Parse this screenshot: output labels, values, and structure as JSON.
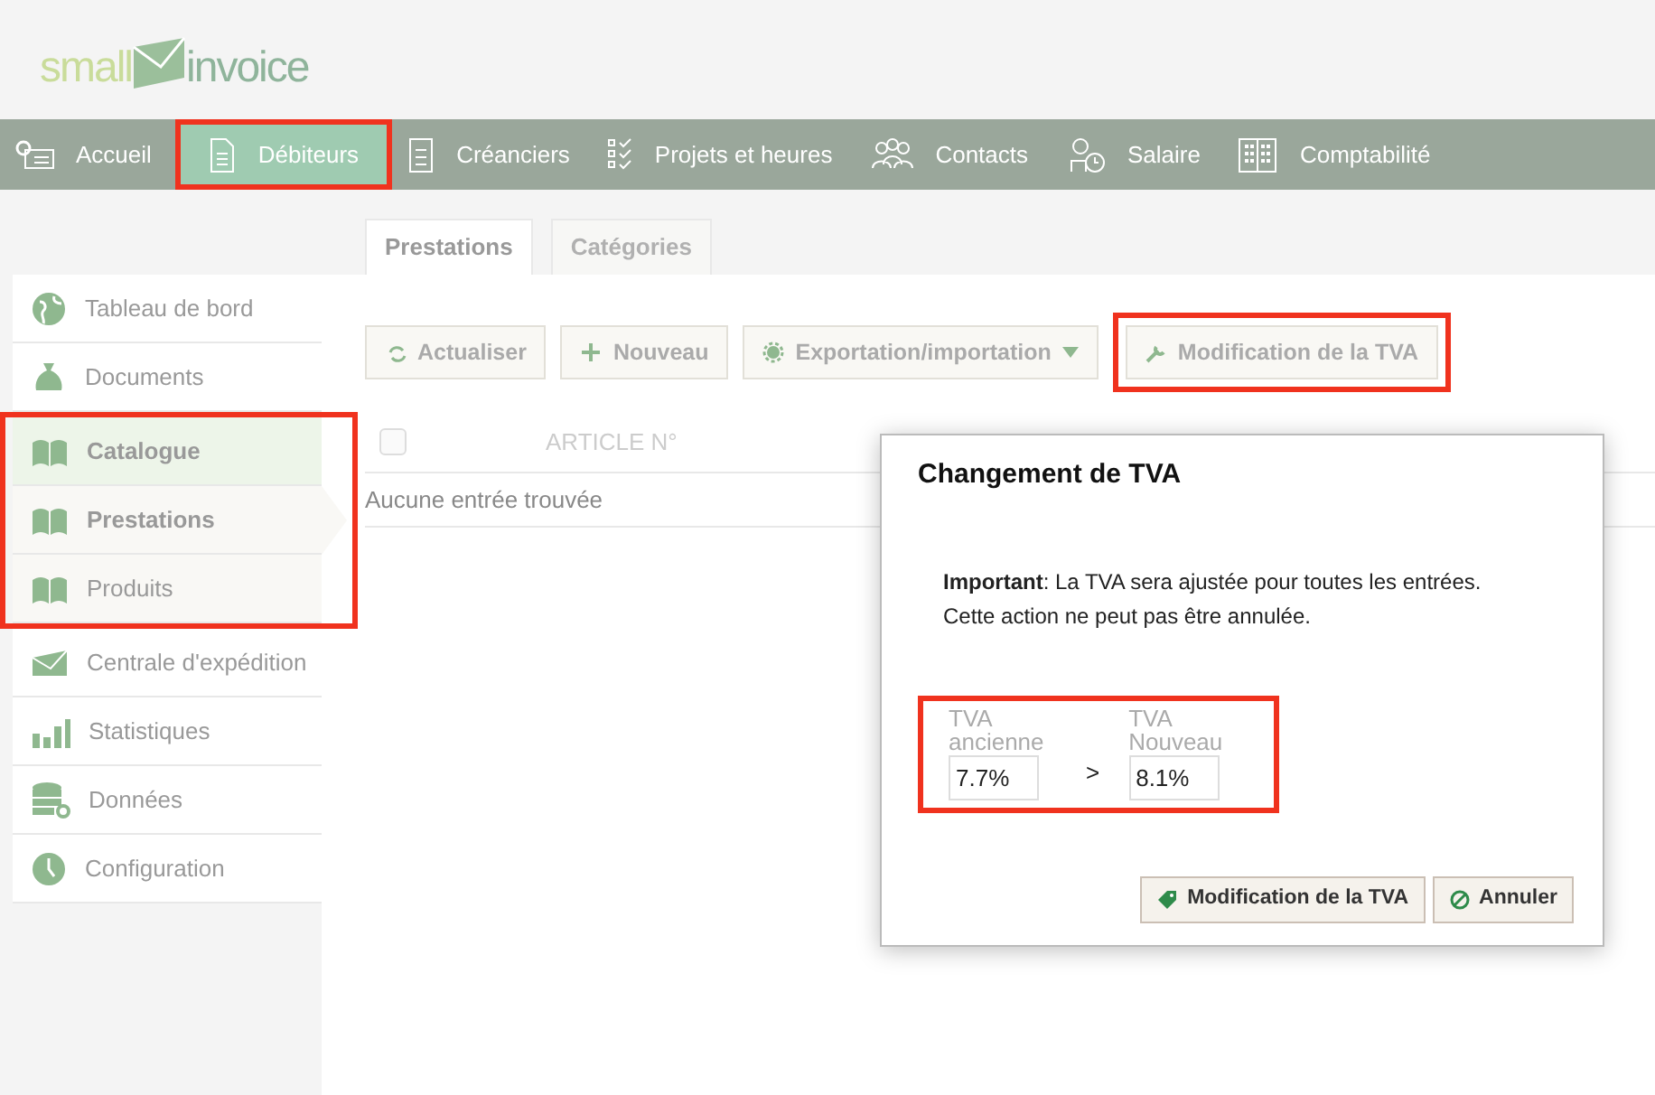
{
  "logo": {
    "part_1": "small",
    "part_2": "invoice"
  },
  "main_nav": [
    {
      "label": "Accueil",
      "selected": false,
      "highlighted": false
    },
    {
      "label": "Débiteurs",
      "selected": true,
      "highlighted": true
    },
    {
      "label": "Créanciers",
      "selected": false,
      "highlighted": false
    },
    {
      "label": "Projets et heures",
      "selected": false,
      "highlighted": false
    },
    {
      "label": "Contacts",
      "selected": false,
      "highlighted": false
    },
    {
      "label": "Salaire",
      "selected": false,
      "highlighted": false
    },
    {
      "label": "Comptabilité",
      "selected": false,
      "highlighted": false
    }
  ],
  "tabs": [
    {
      "label": "Prestations",
      "selected": true
    },
    {
      "label": "Catégories",
      "selected": false
    }
  ],
  "sidebar": {
    "items": [
      {
        "label": "Tableau de bord",
        "selected": false,
        "highlighted": false
      },
      {
        "label": "Documents",
        "selected": false,
        "highlighted": false
      },
      {
        "label": "Catalogue",
        "selected": false,
        "expanded": true,
        "highlighted": true,
        "children": [
          {
            "label": "Prestations",
            "selected": true,
            "highlighted": true
          },
          {
            "label": "Produits",
            "selected": false,
            "highlighted": true
          }
        ]
      },
      {
        "label": "Centrale d'expédition",
        "selected": false,
        "highlighted": false
      },
      {
        "label": "Statistiques",
        "selected": false,
        "highlighted": false
      },
      {
        "label": "Données",
        "selected": false,
        "highlighted": false
      },
      {
        "label": "Configuration",
        "selected": false,
        "highlighted": false
      }
    ]
  },
  "toolbar": [
    {
      "label": "Actualiser",
      "dropdown": false,
      "highlighted": false
    },
    {
      "label": "Nouveau",
      "dropdown": false,
      "highlighted": false
    },
    {
      "label": "Exportation/importation",
      "dropdown": true,
      "highlighted": false
    },
    {
      "label": "Modification de la TVA",
      "dropdown": false,
      "highlighted": true
    }
  ],
  "table": {
    "columns": [
      "ARTICLE N°"
    ],
    "select_all_checked": false,
    "empty_text": "Aucune entrée trouvée"
  },
  "dialog": {
    "title": "Changement de TVA",
    "message": [
      "**Important**: La TVA sera ajustée pour toutes les entrées.",
      "Cette action ne peut pas être annulée."
    ],
    "fields_highlighted": true,
    "old_field": {
      "label": "TVA ancienne",
      "value": "7.7%"
    },
    "separator": ">",
    "new_field": {
      "label": "TVA Nouveau",
      "value": "8.1%"
    },
    "buttons": [
      {
        "label": "Modification de la TVA"
      },
      {
        "label": "Annuler"
      }
    ]
  }
}
